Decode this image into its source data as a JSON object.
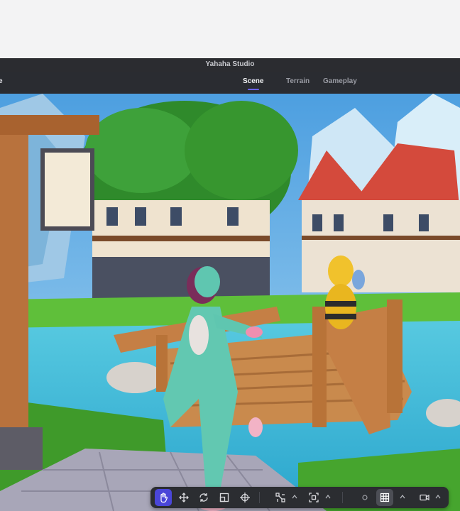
{
  "window": {
    "title": "Yahaha Studio",
    "left_label_fragment": "e"
  },
  "tabs": [
    {
      "label": "Scene",
      "active": true
    },
    {
      "label": "Terrain",
      "active": false
    },
    {
      "label": "Gameplay",
      "active": false
    }
  ],
  "toolbar": {
    "tools": [
      {
        "name": "hand-tool",
        "icon": "hand-icon",
        "active": true
      },
      {
        "name": "move-tool",
        "icon": "move-arrows-icon",
        "active": false
      },
      {
        "name": "rotate-tool",
        "icon": "rotate-icon",
        "active": false
      },
      {
        "name": "scale-tool",
        "icon": "scale-icon",
        "active": false
      },
      {
        "name": "transform-tool",
        "icon": "crosshair-icon",
        "active": false
      },
      {
        "name": "pivot-tool",
        "icon": "pivot-icon",
        "active": false
      },
      {
        "name": "snap-tool",
        "icon": "focus-icon",
        "active": false
      },
      {
        "name": "dot-tool",
        "icon": "circle-icon",
        "active": false
      },
      {
        "name": "grid-tool",
        "icon": "grid-icon",
        "active": true
      },
      {
        "name": "camera-tool",
        "icon": "camera-icon",
        "active": false
      }
    ]
  },
  "colors": {
    "accent": "#4a46d8",
    "tab_underline": "#6c63ff",
    "toolbar_bg": "#2b2d31"
  }
}
